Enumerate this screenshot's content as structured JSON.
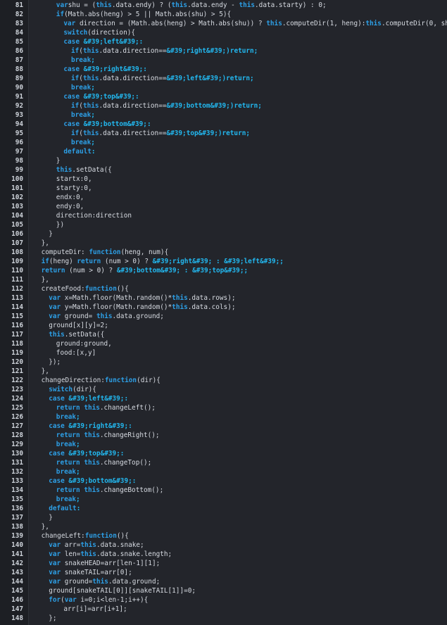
{
  "editor": {
    "colors": {
      "background": "#23252b",
      "gutter": "#1d1f24",
      "text": "#d7dbe2",
      "keyword": "#2d9fe6",
      "string": "#22b8f0",
      "line_number": "#ced3da"
    },
    "lines": [
      {
        "n": "81",
        "indent": 3,
        "tokens": [
          [
            "kw",
            "var"
          ],
          [
            "",
            "shu = ("
          ],
          [
            "th",
            "this"
          ],
          [
            "",
            ".data.endy) ? ("
          ],
          [
            "th",
            "this"
          ],
          [
            "",
            ".data.endy - "
          ],
          [
            "th",
            "this"
          ],
          [
            "",
            ".data.starty) : 0;"
          ]
        ]
      },
      {
        "n": "82",
        "indent": 3,
        "tokens": [
          [
            "kw",
            "if"
          ],
          [
            "",
            "(Math.abs(heng) > 5 || Math.abs(shu) > 5){"
          ]
        ]
      },
      {
        "n": "83",
        "indent": 4,
        "tokens": [
          [
            "kw",
            "var"
          ],
          [
            "",
            " direction = (Math.abs(heng) > Math.abs(shu)) ? "
          ],
          [
            "th",
            "this"
          ],
          [
            "",
            ".computeDir(1, heng):"
          ],
          [
            "th",
            "this"
          ],
          [
            "",
            ".computeDir(0, shu);"
          ]
        ]
      },
      {
        "n": "84",
        "indent": 4,
        "tokens": [
          [
            "kw",
            "switch"
          ],
          [
            "",
            "(direction){"
          ]
        ]
      },
      {
        "n": "85",
        "indent": 4,
        "tokens": [
          [
            "kw",
            "case"
          ],
          [
            "",
            " "
          ],
          [
            "st",
            "&#39;left&#39;"
          ],
          [
            "st",
            ":"
          ]
        ]
      },
      {
        "n": "86",
        "indent": 5,
        "tokens": [
          [
            "kw",
            "if"
          ],
          [
            "",
            "("
          ],
          [
            "th",
            "this"
          ],
          [
            "",
            ".data.direction=="
          ],
          [
            "st",
            "&#39;right&#39;"
          ],
          [
            "st",
            ")return;"
          ]
        ]
      },
      {
        "n": "87",
        "indent": 5,
        "tokens": [
          [
            "kw",
            "break"
          ],
          [
            "st",
            ";"
          ]
        ]
      },
      {
        "n": "88",
        "indent": 4,
        "tokens": [
          [
            "kw",
            "case"
          ],
          [
            "",
            " "
          ],
          [
            "st",
            "&#39;right&#39;"
          ],
          [
            "st",
            ":"
          ]
        ]
      },
      {
        "n": "89",
        "indent": 5,
        "tokens": [
          [
            "kw",
            "if"
          ],
          [
            "",
            "("
          ],
          [
            "th",
            "this"
          ],
          [
            "",
            ".data.direction=="
          ],
          [
            "st",
            "&#39;left&#39;"
          ],
          [
            "st",
            ")return;"
          ]
        ]
      },
      {
        "n": "90",
        "indent": 5,
        "tokens": [
          [
            "kw",
            "break"
          ],
          [
            "st",
            ";"
          ]
        ]
      },
      {
        "n": "91",
        "indent": 4,
        "tokens": [
          [
            "kw",
            "case"
          ],
          [
            "",
            " "
          ],
          [
            "st",
            "&#39;top&#39;"
          ],
          [
            "st",
            ":"
          ]
        ]
      },
      {
        "n": "92",
        "indent": 5,
        "tokens": [
          [
            "kw",
            "if"
          ],
          [
            "",
            "("
          ],
          [
            "th",
            "this"
          ],
          [
            "",
            ".data.direction=="
          ],
          [
            "st",
            "&#39;bottom&#39;"
          ],
          [
            "st",
            ")return;"
          ]
        ]
      },
      {
        "n": "93",
        "indent": 5,
        "tokens": [
          [
            "kw",
            "break"
          ],
          [
            "st",
            ";"
          ]
        ]
      },
      {
        "n": "94",
        "indent": 4,
        "tokens": [
          [
            "kw",
            "case"
          ],
          [
            "",
            " "
          ],
          [
            "st",
            "&#39;bottom&#39;"
          ],
          [
            "st",
            ":"
          ]
        ]
      },
      {
        "n": "95",
        "indent": 5,
        "tokens": [
          [
            "kw",
            "if"
          ],
          [
            "",
            "("
          ],
          [
            "th",
            "this"
          ],
          [
            "",
            ".data.direction=="
          ],
          [
            "st",
            "&#39;top&#39;"
          ],
          [
            "st",
            ")return;"
          ]
        ]
      },
      {
        "n": "96",
        "indent": 5,
        "tokens": [
          [
            "kw",
            "break"
          ],
          [
            "st",
            ";"
          ]
        ]
      },
      {
        "n": "97",
        "indent": 4,
        "tokens": [
          [
            "kw",
            "default"
          ],
          [
            "st",
            ":"
          ]
        ]
      },
      {
        "n": "98",
        "indent": 3,
        "tokens": [
          [
            "",
            "}"
          ]
        ]
      },
      {
        "n": "99",
        "indent": 3,
        "tokens": [
          [
            "th",
            "this"
          ],
          [
            "",
            ".setData({"
          ]
        ]
      },
      {
        "n": "100",
        "indent": 3,
        "tokens": [
          [
            "",
            "startx:0,"
          ]
        ]
      },
      {
        "n": "101",
        "indent": 3,
        "tokens": [
          [
            "",
            "starty:0,"
          ]
        ]
      },
      {
        "n": "102",
        "indent": 3,
        "tokens": [
          [
            "",
            "endx:0,"
          ]
        ]
      },
      {
        "n": "103",
        "indent": 3,
        "tokens": [
          [
            "",
            "endy:0,"
          ]
        ]
      },
      {
        "n": "104",
        "indent": 3,
        "tokens": [
          [
            "",
            "direction:direction"
          ]
        ]
      },
      {
        "n": "105",
        "indent": 3,
        "tokens": [
          [
            "",
            "})"
          ]
        ]
      },
      {
        "n": "106",
        "indent": 2,
        "tokens": [
          [
            "",
            "}"
          ]
        ]
      },
      {
        "n": "107",
        "indent": 1,
        "tokens": [
          [
            "",
            "},"
          ]
        ]
      },
      {
        "n": "108",
        "indent": 1,
        "tokens": [
          [
            "",
            "computeDir: "
          ],
          [
            "fn",
            "function"
          ],
          [
            "",
            "(heng, num){"
          ]
        ]
      },
      {
        "n": "109",
        "indent": 1,
        "tokens": [
          [
            "kw",
            "if"
          ],
          [
            "",
            "(heng) "
          ],
          [
            "kw",
            "return"
          ],
          [
            "",
            " (num > 0) ? "
          ],
          [
            "st",
            "&#39;right&#39;"
          ],
          [
            "st",
            " : "
          ],
          [
            "st",
            "&#39;left&#39;"
          ],
          [
            "st",
            ";"
          ]
        ]
      },
      {
        "n": "110",
        "indent": 1,
        "tokens": [
          [
            "kw",
            "return"
          ],
          [
            "",
            " (num > 0) ? "
          ],
          [
            "st",
            "&#39;bottom&#39;"
          ],
          [
            "st",
            " : "
          ],
          [
            "st",
            "&#39;top&#39;"
          ],
          [
            "st",
            ";"
          ]
        ]
      },
      {
        "n": "111",
        "indent": 1,
        "tokens": [
          [
            "",
            "},"
          ]
        ]
      },
      {
        "n": "112",
        "indent": 1,
        "tokens": [
          [
            "",
            "createFood:"
          ],
          [
            "fn",
            "function"
          ],
          [
            "",
            "(){"
          ]
        ]
      },
      {
        "n": "113",
        "indent": 2,
        "tokens": [
          [
            "kw",
            "var"
          ],
          [
            "",
            " x=Math.floor(Math.random()*"
          ],
          [
            "th",
            "this"
          ],
          [
            "",
            ".data.rows);"
          ]
        ]
      },
      {
        "n": "114",
        "indent": 2,
        "tokens": [
          [
            "kw",
            "var"
          ],
          [
            "",
            " y=Math.floor(Math.random()*"
          ],
          [
            "th",
            "this"
          ],
          [
            "",
            ".data.cols);"
          ]
        ]
      },
      {
        "n": "115",
        "indent": 2,
        "tokens": [
          [
            "kw",
            "var"
          ],
          [
            "",
            " ground= "
          ],
          [
            "th",
            "this"
          ],
          [
            "",
            ".data.ground;"
          ]
        ]
      },
      {
        "n": "116",
        "indent": 2,
        "tokens": [
          [
            "",
            "ground[x][y]=2;"
          ]
        ]
      },
      {
        "n": "117",
        "indent": 2,
        "tokens": [
          [
            "th",
            "this"
          ],
          [
            "",
            ".setData({"
          ]
        ]
      },
      {
        "n": "118",
        "indent": 3,
        "tokens": [
          [
            "",
            "ground:ground,"
          ]
        ]
      },
      {
        "n": "119",
        "indent": 3,
        "tokens": [
          [
            "",
            "food:[x,y]"
          ]
        ]
      },
      {
        "n": "120",
        "indent": 2,
        "tokens": [
          [
            "",
            "});"
          ]
        ]
      },
      {
        "n": "121",
        "indent": 1,
        "tokens": [
          [
            "",
            "},"
          ]
        ]
      },
      {
        "n": "122",
        "indent": 1,
        "tokens": [
          [
            "",
            "changeDirection:"
          ],
          [
            "fn",
            "function"
          ],
          [
            "",
            "(dir){"
          ]
        ]
      },
      {
        "n": "123",
        "indent": 2,
        "tokens": [
          [
            "kw",
            "switch"
          ],
          [
            "",
            "(dir){"
          ]
        ]
      },
      {
        "n": "124",
        "indent": 2,
        "tokens": [
          [
            "kw",
            "case"
          ],
          [
            "",
            " "
          ],
          [
            "st",
            "&#39;left&#39;"
          ],
          [
            "st",
            ":"
          ]
        ]
      },
      {
        "n": "125",
        "indent": 3,
        "tokens": [
          [
            "kw",
            "return"
          ],
          [
            "",
            " "
          ],
          [
            "th",
            "this"
          ],
          [
            "",
            ".changeLeft();"
          ]
        ]
      },
      {
        "n": "126",
        "indent": 3,
        "tokens": [
          [
            "kw",
            "break"
          ],
          [
            "st",
            ";"
          ]
        ]
      },
      {
        "n": "127",
        "indent": 2,
        "tokens": [
          [
            "kw",
            "case"
          ],
          [
            "",
            " "
          ],
          [
            "st",
            "&#39;right&#39;"
          ],
          [
            "st",
            ":"
          ]
        ]
      },
      {
        "n": "128",
        "indent": 3,
        "tokens": [
          [
            "kw",
            "return"
          ],
          [
            "",
            " "
          ],
          [
            "th",
            "this"
          ],
          [
            "",
            ".changeRight();"
          ]
        ]
      },
      {
        "n": "129",
        "indent": 3,
        "tokens": [
          [
            "kw",
            "break"
          ],
          [
            "st",
            ";"
          ]
        ]
      },
      {
        "n": "130",
        "indent": 2,
        "tokens": [
          [
            "kw",
            "case"
          ],
          [
            "",
            " "
          ],
          [
            "st",
            "&#39;top&#39;"
          ],
          [
            "st",
            ":"
          ]
        ]
      },
      {
        "n": "131",
        "indent": 3,
        "tokens": [
          [
            "kw",
            "return"
          ],
          [
            "",
            " "
          ],
          [
            "th",
            "this"
          ],
          [
            "",
            ".changeTop();"
          ]
        ]
      },
      {
        "n": "132",
        "indent": 3,
        "tokens": [
          [
            "kw",
            "break"
          ],
          [
            "st",
            ";"
          ]
        ]
      },
      {
        "n": "133",
        "indent": 2,
        "tokens": [
          [
            "kw",
            "case"
          ],
          [
            "",
            " "
          ],
          [
            "st",
            "&#39;bottom&#39;"
          ],
          [
            "st",
            ":"
          ]
        ]
      },
      {
        "n": "134",
        "indent": 3,
        "tokens": [
          [
            "kw",
            "return"
          ],
          [
            "",
            " "
          ],
          [
            "th",
            "this"
          ],
          [
            "",
            ".changeBottom();"
          ]
        ]
      },
      {
        "n": "135",
        "indent": 3,
        "tokens": [
          [
            "kw",
            "break"
          ],
          [
            "st",
            ";"
          ]
        ]
      },
      {
        "n": "136",
        "indent": 2,
        "tokens": [
          [
            "kw",
            "default"
          ],
          [
            "st",
            ":"
          ]
        ]
      },
      {
        "n": "137",
        "indent": 2,
        "tokens": [
          [
            "",
            "}"
          ]
        ]
      },
      {
        "n": "138",
        "indent": 1,
        "tokens": [
          [
            "",
            "},"
          ]
        ]
      },
      {
        "n": "139",
        "indent": 1,
        "tokens": [
          [
            "",
            "changeLeft:"
          ],
          [
            "fn",
            "function"
          ],
          [
            "",
            "(){"
          ]
        ]
      },
      {
        "n": "140",
        "indent": 2,
        "tokens": [
          [
            "kw",
            "var"
          ],
          [
            "",
            " arr="
          ],
          [
            "th",
            "this"
          ],
          [
            "",
            ".data.snake;"
          ]
        ]
      },
      {
        "n": "141",
        "indent": 2,
        "tokens": [
          [
            "kw",
            "var"
          ],
          [
            "",
            " len="
          ],
          [
            "th",
            "this"
          ],
          [
            "",
            ".data.snake.length;"
          ]
        ]
      },
      {
        "n": "142",
        "indent": 2,
        "tokens": [
          [
            "kw",
            "var"
          ],
          [
            "",
            " snakeHEAD=arr[len-1][1];"
          ]
        ]
      },
      {
        "n": "143",
        "indent": 2,
        "tokens": [
          [
            "kw",
            "var"
          ],
          [
            "",
            " snakeTAIL=arr[0];"
          ]
        ]
      },
      {
        "n": "144",
        "indent": 2,
        "tokens": [
          [
            "kw",
            "var"
          ],
          [
            "",
            " ground="
          ],
          [
            "th",
            "this"
          ],
          [
            "",
            ".data.ground;"
          ]
        ]
      },
      {
        "n": "145",
        "indent": 2,
        "tokens": [
          [
            "",
            "ground[snakeTAIL[0]][snakeTAIL[1]]=0;"
          ]
        ]
      },
      {
        "n": "146",
        "indent": 2,
        "tokens": [
          [
            "kw",
            "for"
          ],
          [
            "",
            "("
          ],
          [
            "kw",
            "var"
          ],
          [
            "",
            " i=0;i<len-1;i++){"
          ]
        ]
      },
      {
        "n": "147",
        "indent": 4,
        "tokens": [
          [
            "",
            "arr[i]=arr[i+1];"
          ]
        ]
      },
      {
        "n": "148",
        "indent": 2,
        "tokens": [
          [
            "",
            "};"
          ]
        ]
      }
    ]
  }
}
